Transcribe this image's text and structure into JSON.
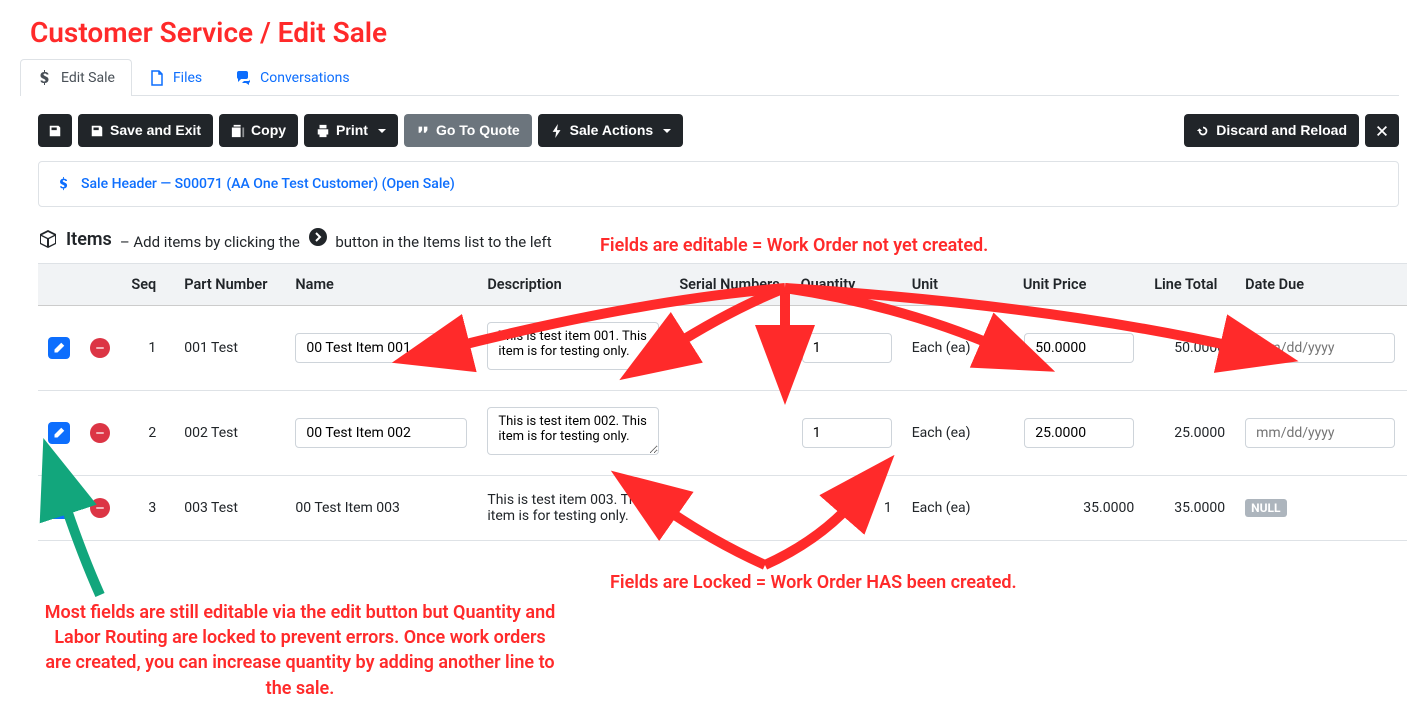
{
  "page_title": "Customer Service / Edit Sale",
  "tabs": [
    {
      "label": "Edit Sale",
      "icon": "dollar-icon"
    },
    {
      "label": "Files",
      "icon": "file-icon"
    },
    {
      "label": "Conversations",
      "icon": "chat-icon"
    }
  ],
  "toolbar": {
    "save_icon": "save",
    "save_exit": "Save and Exit",
    "copy": "Copy",
    "print": "Print",
    "go_to_quote": "Go To Quote",
    "sale_actions": "Sale Actions",
    "discard": "Discard and Reload",
    "close_icon": "close"
  },
  "sale_header": {
    "label": "Sale Header — S00071 (AA One Test Customer) (Open Sale)"
  },
  "items_section": {
    "heading": "Items",
    "subheading_pre": "– Add items by clicking the",
    "subheading_post": "button in the Items list to the left"
  },
  "columns": {
    "seq": "Seq",
    "part_number": "Part Number",
    "name": "Name",
    "description": "Description",
    "serial": "Serial Numbers",
    "quantity": "Quantity",
    "unit": "Unit",
    "unit_price": "Unit Price",
    "line_total": "Line Total",
    "date_due": "Date Due"
  },
  "rows": [
    {
      "seq": "1",
      "part_number": "001 Test",
      "name": "00 Test Item 001",
      "description": "This is test item 001. This item is for testing only.",
      "quantity": "1",
      "unit": "Each (ea)",
      "unit_price": "50.0000",
      "line_total": "50.0000",
      "date_due_placeholder": "mm/dd/yyyy",
      "editable": true
    },
    {
      "seq": "2",
      "part_number": "002 Test",
      "name": "00 Test Item 002",
      "description": "This is test item 002. This item is for testing only.",
      "quantity": "1",
      "unit": "Each (ea)",
      "unit_price": "25.0000",
      "line_total": "25.0000",
      "date_due_placeholder": "mm/dd/yyyy",
      "editable": true
    },
    {
      "seq": "3",
      "part_number": "003 Test",
      "name": "00 Test Item 003",
      "description": "This is test item 003. This item is for testing only.",
      "quantity": "1",
      "unit": "Each (ea)",
      "unit_price": "35.0000",
      "line_total": "35.0000",
      "date_due_null": "NULL",
      "editable": false
    }
  ],
  "annotations": {
    "top": "Fields are editable = Work Order not yet created.",
    "bottom": "Fields are Locked = Work Order HAS been created.",
    "left": "Most fields are still editable via the edit button but Quantity and Labor Routing are locked to prevent errors. Once work orders are created, you can increase quantity by adding another line to the sale."
  }
}
